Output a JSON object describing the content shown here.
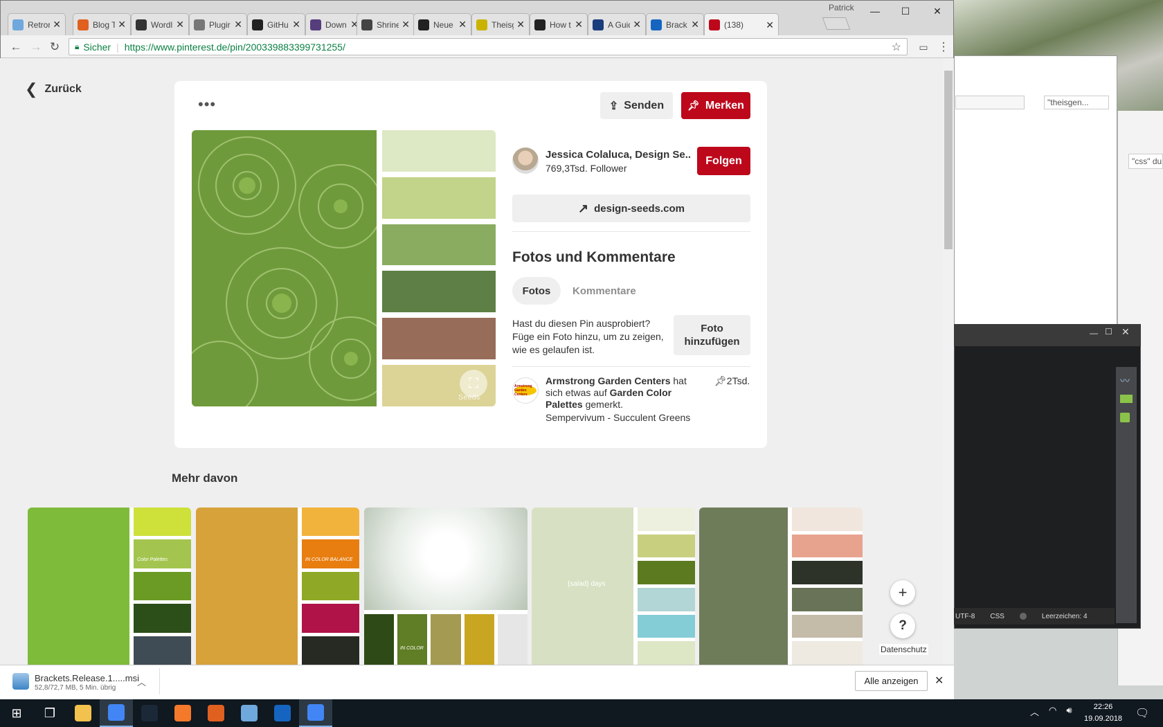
{
  "browser": {
    "profile": "Patrick",
    "tabs": [
      {
        "label": "Retror",
        "icon": "retro-icon",
        "color": "#6fa8dc"
      },
      {
        "label": "Blog T",
        "icon": "brackets-icon",
        "color": "#e06020"
      },
      {
        "label": "Wordl",
        "icon": "floppy-icon",
        "color": "#333333"
      },
      {
        "label": "Plugir",
        "icon": "wordpress-icon",
        "color": "#777777"
      },
      {
        "label": "GitHu",
        "icon": "github-icon",
        "color": "#222222"
      },
      {
        "label": "Down",
        "icon": "bootstrap-icon",
        "color": "#563d7c"
      },
      {
        "label": "Shrine",
        "icon": "circle-icon",
        "color": "#444444"
      },
      {
        "label": "Neue",
        "icon": "eye-icon",
        "color": "#222222"
      },
      {
        "label": "Theisg",
        "icon": "theisgen-icon",
        "color": "#c9b300"
      },
      {
        "label": "How t",
        "icon": "medium-icon",
        "color": "#222222"
      },
      {
        "label": "A Guid",
        "icon": "hg-icon",
        "color": "#1a3d7c"
      },
      {
        "label": "Brack",
        "icon": "brackets-blue-icon",
        "color": "#1565c0"
      },
      {
        "label": "(138)",
        "icon": "pinterest-icon",
        "color": "#bd081c"
      }
    ],
    "secure_label": "Sicher",
    "url": "https://www.pinterest.de/pin/200339883399731255/"
  },
  "pin": {
    "back_label": "Zurück",
    "send_label": "Senden",
    "save_label": "Merken",
    "author": "Jessica Colaluca, Design Se...",
    "followers": "769,3Tsd. Follower",
    "follow_label": "Folgen",
    "link_label": "design-seeds.com",
    "section_title": "Fotos und Kommentare",
    "tab_photos": "Fotos",
    "tab_comments": "Kommentare",
    "tried_text": "Hast du diesen Pin ausprobiert? Füge ein Foto hinzu, um zu zeigen, wie es gelaufen ist.",
    "add_photo_label": "Foto hinzufügen",
    "saver_name": "Armstrong Garden Centers",
    "saver_mid": " hat sich etwas auf ",
    "board_name": "Garden Color Palettes",
    "saver_end": " gemerkt.",
    "pin_count": "2Tsd.",
    "description": "Sempervivum - Succulent Greens",
    "logo_text": "Armstrong Garden Centers",
    "palette": [
      "#dde8c4",
      "#c2d38a",
      "#8aac60",
      "#5e7f45",
      "#976c59",
      "#dcd396"
    ],
    "image_color": "#6f9a3b",
    "watermark": "Seeds"
  },
  "more": {
    "title": "Mehr davon",
    "cards": [
      {
        "photo": "#7fbb3a",
        "swatches": [
          "#cde13a",
          "#a3c54f",
          "#6b9a25",
          "#2c4e18",
          "#3f4b55"
        ],
        "caption": "Color Palettes"
      },
      {
        "photo": "#d8a23a",
        "swatches": [
          "#f2b33c",
          "#e87e10",
          "#8fa825",
          "#b01347",
          "#262a22"
        ],
        "caption": "IN COLOR BALANCE"
      },
      {
        "photo": "#e6ece6",
        "swatches": [
          "#2e4a16",
          "#5f7e25",
          "#a59a51",
          "#c9a622",
          "#e6e6e6"
        ],
        "caption": "IN COLOR"
      },
      {
        "photo": "#d7e0c2",
        "swatches": [
          "#eef0df",
          "#c8cf7f",
          "#5c7a20",
          "#b2d5d5",
          "#84ccd6",
          "#dde6c5"
        ],
        "caption": "{salad} days"
      },
      {
        "photo": "#6f7c5a",
        "swatches": [
          "#f0e6de",
          "#e8a38f",
          "#2d3328",
          "#697357",
          "#c4bba9",
          "#eeeae2"
        ],
        "caption": ""
      }
    ],
    "privacy_label": "Datenschutz"
  },
  "download": {
    "filename": "Brackets.Release.1.....msi",
    "progress": "52,8/72,7 MB, 5 Min. übrig",
    "show_all": "Alle anzeigen"
  },
  "background": {
    "explorer_search": "\"theisgen...",
    "right_search": "\"css\" du",
    "status_encoding": "UTF-8",
    "status_lang": "CSS",
    "status_chars": "Leerzeichen: 4"
  },
  "taskbar": {
    "time": "22:26",
    "date": "19.09.2018",
    "apps": [
      {
        "name": "file-explorer",
        "color": "#f2c14e"
      },
      {
        "name": "chrome",
        "color": "#4285f4"
      },
      {
        "name": "steam",
        "color": "#1b2838"
      },
      {
        "name": "blender",
        "color": "#f5792a"
      },
      {
        "name": "brackets",
        "color": "#e06020"
      },
      {
        "name": "notepad",
        "color": "#6fa8dc"
      },
      {
        "name": "brackets-blue",
        "color": "#1565c0"
      },
      {
        "name": "chrome-2",
        "color": "#4285f4"
      }
    ]
  }
}
